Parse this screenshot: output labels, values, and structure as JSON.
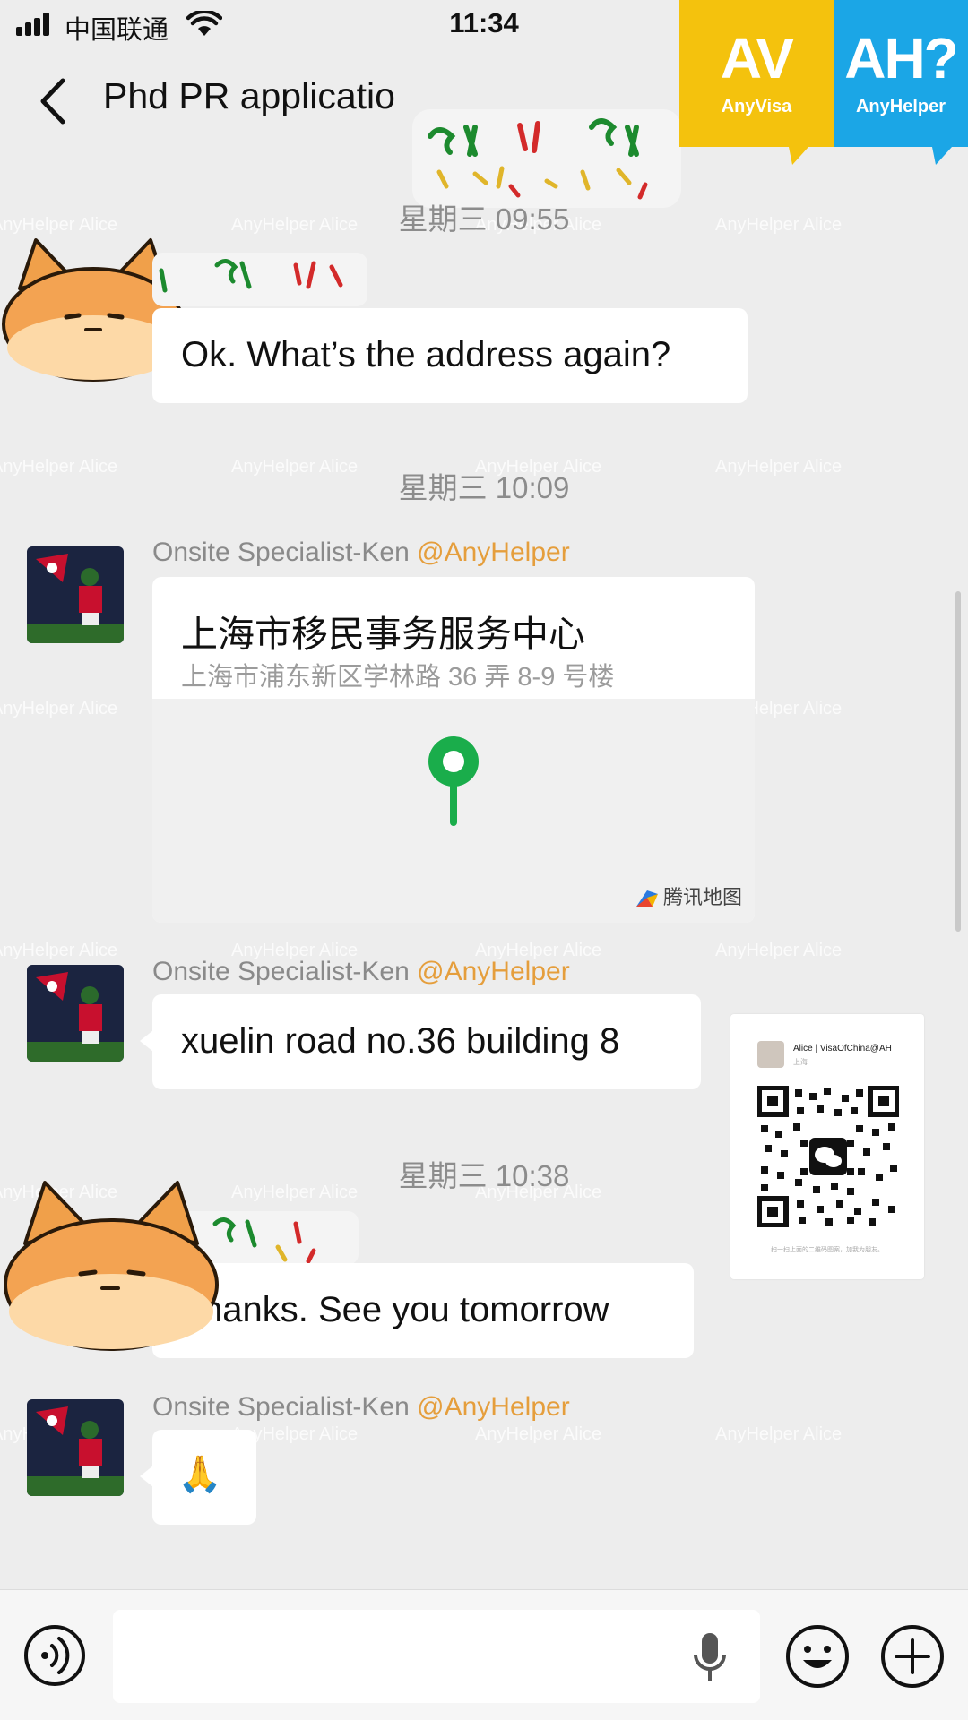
{
  "status_bar": {
    "carrier": "中国联通",
    "time": "11:34"
  },
  "nav": {
    "title": "Phd PR applicatio",
    "back_icon": "chevron-left-icon"
  },
  "logos": {
    "anyvisa": {
      "mark": "AV",
      "name": "AnyVisa",
      "color": "#f4c20d"
    },
    "anyhelper": {
      "mark": "AH?",
      "name": "AnyHelper",
      "color": "#1ba6e6"
    }
  },
  "watermark_text": "AnyHelper Alice",
  "messages": {
    "divider_1": "星期三 09:55",
    "msg_1": "Ok. What’s the address again?",
    "divider_2": "星期三 10:09",
    "sender_name": "Onsite Specialist-Ken",
    "sender_org": "@AnyHelper",
    "location": {
      "title": "上海市移民事务服务中心",
      "address": "上海市浦东新区学林路 36 弄 8-9 号楼",
      "map_brand": "腾讯地图"
    },
    "msg_3": "xuelin road no.36 building 8",
    "divider_3": "星期三 10:38",
    "msg_4": "hanks. See you tomorrow",
    "msg_5_emoji": "🙏"
  },
  "qr_card": {
    "name": "Alice | VisaOfChina@AH",
    "sub": "上海",
    "footer": "扫一扫上面的二维码图案，加我为朋友。"
  },
  "colors": {
    "background": "#ededed",
    "bubble": "#ffffff",
    "accent_org": "#e59e3c",
    "map_pin": "#1aad4b"
  }
}
